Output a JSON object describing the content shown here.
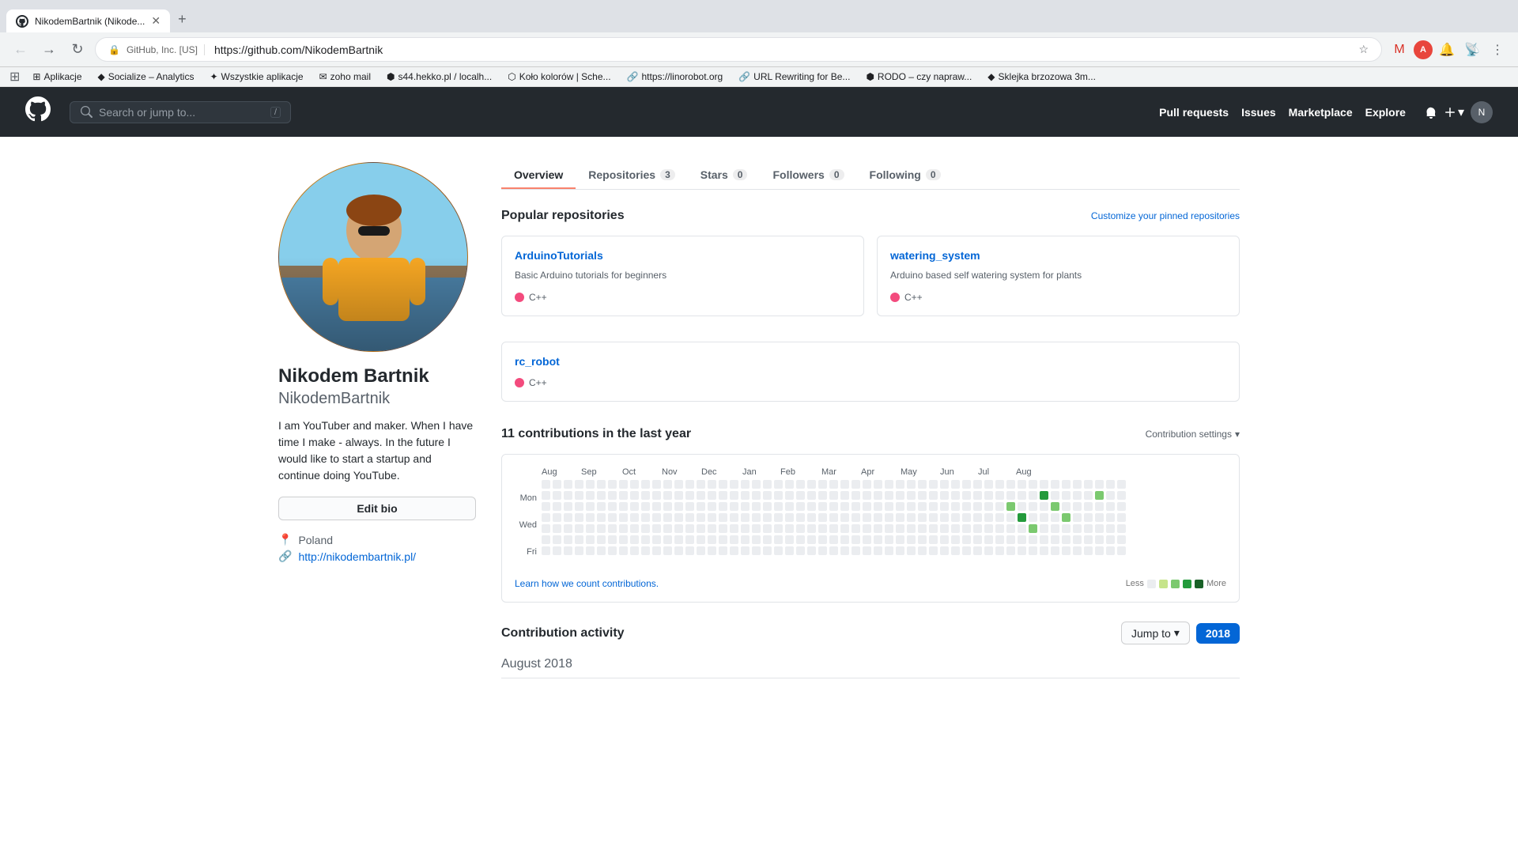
{
  "browser": {
    "tab_title": "NikodemBartnik (Nikode...",
    "url_badge": "GitHub, Inc. [US]",
    "url": "https://github.com/NikodemBartnik",
    "new_tab_label": "+"
  },
  "bookmarks": [
    {
      "id": "apps",
      "label": "Aplikacje",
      "icon": "⊞"
    },
    {
      "id": "socialize",
      "label": "Socialize – Analytics",
      "icon": "◆"
    },
    {
      "id": "wszystkie",
      "label": "Wszystkie aplikacje",
      "icon": "✦"
    },
    {
      "id": "zoho",
      "label": "zoho mail",
      "icon": "✉"
    },
    {
      "id": "s44",
      "label": "s44.hekko.pl / localh...",
      "icon": "⬢"
    },
    {
      "id": "kolo",
      "label": "Koło kolorów | Sche...",
      "icon": "⬡"
    },
    {
      "id": "linorobot",
      "label": "https://linorobot.org",
      "icon": "🔗"
    },
    {
      "id": "url-rewriting",
      "label": "URL Rewriting for Be...",
      "icon": "🔗"
    },
    {
      "id": "rodo",
      "label": "RODO – czy napraw...",
      "icon": "⬢"
    },
    {
      "id": "sklejka",
      "label": "Sklejka brzozowa 3m...",
      "icon": "◆"
    }
  ],
  "github_header": {
    "search_placeholder": "Search or jump to...",
    "nav_items": [
      {
        "id": "pull-requests",
        "label": "Pull requests"
      },
      {
        "id": "issues",
        "label": "Issues"
      },
      {
        "id": "marketplace",
        "label": "Marketplace"
      },
      {
        "id": "explore",
        "label": "Explore"
      }
    ]
  },
  "profile": {
    "fullname": "Nikodem Bartnik",
    "username": "NikodemBartnik",
    "bio": "I am YouTuber and maker. When I have time I make - always. In the future I would like to start a startup and continue doing YouTube.",
    "edit_bio_label": "Edit bio",
    "location": "Poland",
    "website": "http://nikodembartnik.pl/",
    "tabs": [
      {
        "id": "overview",
        "label": "Overview",
        "count": null,
        "active": true
      },
      {
        "id": "repositories",
        "label": "Repositories",
        "count": "3",
        "active": false
      },
      {
        "id": "stars",
        "label": "Stars",
        "count": "0",
        "active": false
      },
      {
        "id": "followers",
        "label": "Followers",
        "count": "0",
        "active": false
      },
      {
        "id": "following",
        "label": "Following",
        "count": "0",
        "active": false
      }
    ]
  },
  "popular_repos": {
    "section_title": "Popular repositories",
    "customize_label": "Customize your pinned repositories",
    "repos": [
      {
        "id": "arduino-tutorials",
        "name": "ArduinoTutorials",
        "description": "Basic Arduino tutorials for beginners",
        "language": "C++",
        "lang_class": "lang-cpp"
      },
      {
        "id": "watering-system",
        "name": "watering_system",
        "description": "Arduino based self watering system for plants",
        "language": "C++",
        "lang_class": "lang-cpp"
      },
      {
        "id": "rc-robot",
        "name": "rc_robot",
        "description": null,
        "language": "C++",
        "lang_class": "lang-cpp"
      }
    ]
  },
  "contributions": {
    "title": "11 contributions in the last year",
    "settings_label": "Contribution settings",
    "learn_link": "Learn how we count contributions.",
    "legend_less": "Less",
    "legend_more": "More",
    "months": [
      "Aug",
      "Sep",
      "Oct",
      "Nov",
      "Dec",
      "Jan",
      "Feb",
      "Mar",
      "Apr",
      "May",
      "Jun",
      "Jul",
      "Aug"
    ],
    "day_labels": [
      "Mon",
      "",
      "Wed",
      "",
      "Fri"
    ]
  },
  "activity": {
    "title": "Contribution activity",
    "jump_to_label": "Jump to",
    "year": "2018",
    "august_label": "August",
    "august_year": "2018"
  }
}
